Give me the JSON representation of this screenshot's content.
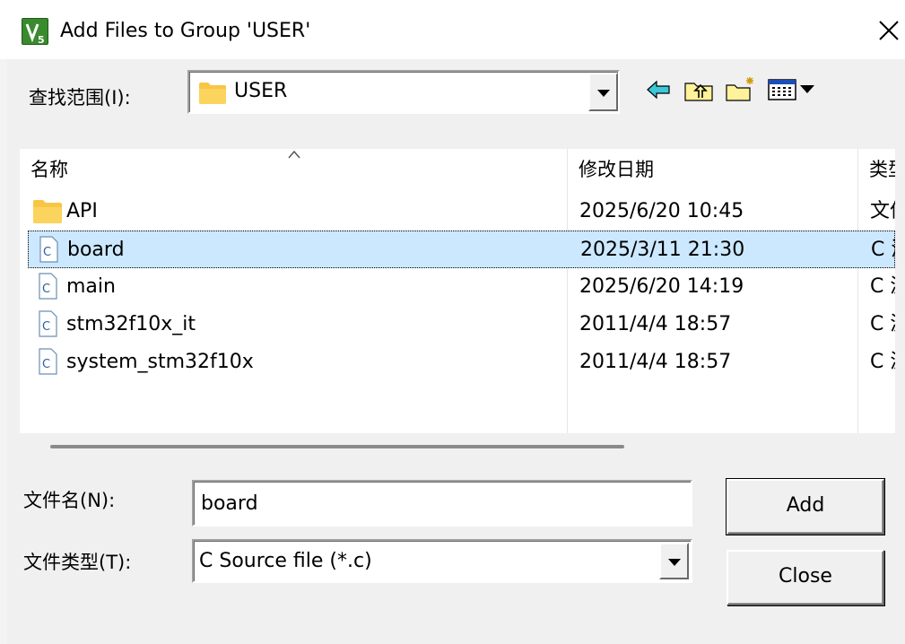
{
  "window": {
    "title": "Add Files to Group 'USER'"
  },
  "look_in": {
    "label": "查找范围(I):",
    "value": "USER"
  },
  "toolbar": {
    "icons": [
      "back-arrow-icon",
      "up-folder-icon",
      "new-folder-icon",
      "view-menu-icon"
    ]
  },
  "file_list": {
    "columns": [
      "名称",
      "修改日期",
      "类型"
    ],
    "rows": [
      {
        "name": "API",
        "date": "2025/6/20 10:45",
        "type": "文件夹",
        "icon": "folder-icon",
        "selected": false
      },
      {
        "name": "board",
        "date": "2025/3/11 21:30",
        "type": "C 源文件",
        "icon": "c-file-icon",
        "selected": true
      },
      {
        "name": "main",
        "date": "2025/6/20 14:19",
        "type": "C 源文件",
        "icon": "c-file-icon",
        "selected": false
      },
      {
        "name": "stm32f10x_it",
        "date": "2011/4/4 18:57",
        "type": "C 源文件",
        "icon": "c-file-icon",
        "selected": false
      },
      {
        "name": "system_stm32f10x",
        "date": "2011/4/4 18:57",
        "type": "C 源文件",
        "icon": "c-file-icon",
        "selected": false
      }
    ]
  },
  "file_name": {
    "label": "文件名(N):",
    "value": "board"
  },
  "file_type": {
    "label": "文件类型(T):",
    "value": "C Source file (*.c)"
  },
  "buttons": {
    "add": "Add",
    "close": "Close"
  },
  "colors": {
    "selection": "#cce8ff",
    "folder": "#f8c645",
    "dialog_bg": "#f0f0f0"
  }
}
